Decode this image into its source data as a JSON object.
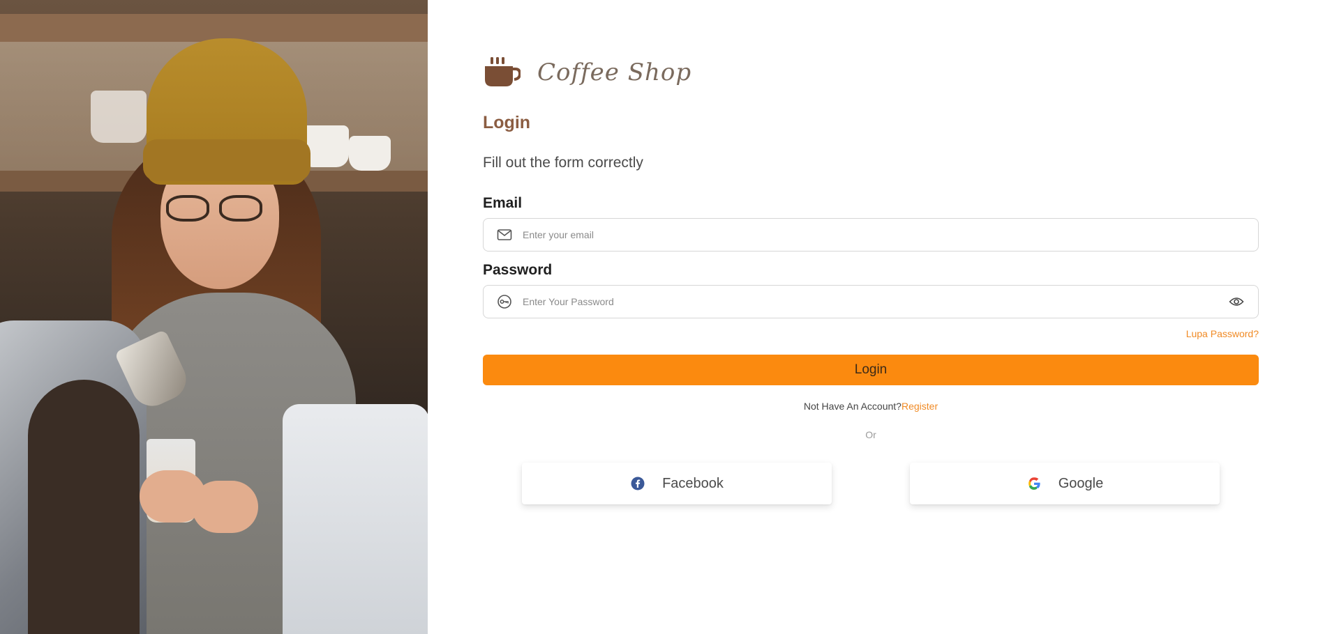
{
  "brand": {
    "name": "Coffee Shop",
    "icon": "coffee-cup-icon",
    "color": "#7a4e35"
  },
  "form": {
    "title": "Login",
    "subtitle": "Fill out the form correctly",
    "email": {
      "label": "Email",
      "placeholder": "Enter your email",
      "value": "",
      "icon": "mail-icon"
    },
    "password": {
      "label": "Password",
      "placeholder": "Enter Your Password",
      "value": "",
      "icon": "key-icon",
      "toggle_icon": "eye-icon"
    },
    "forgot_password": "Lupa Password?",
    "submit_label": "Login",
    "no_account_text": "Not Have An Account?",
    "register_link": "Register",
    "or_text": "Or"
  },
  "social": {
    "facebook": {
      "label": "Facebook",
      "icon": "facebook-icon",
      "color": "#3b5998"
    },
    "google": {
      "label": "Google",
      "icon": "google-icon"
    }
  },
  "colors": {
    "accent": "#fb8a0f",
    "link": "#f08a24",
    "title": "#8b5d42"
  },
  "hero_image": {
    "description_icon": "barista-photo"
  }
}
